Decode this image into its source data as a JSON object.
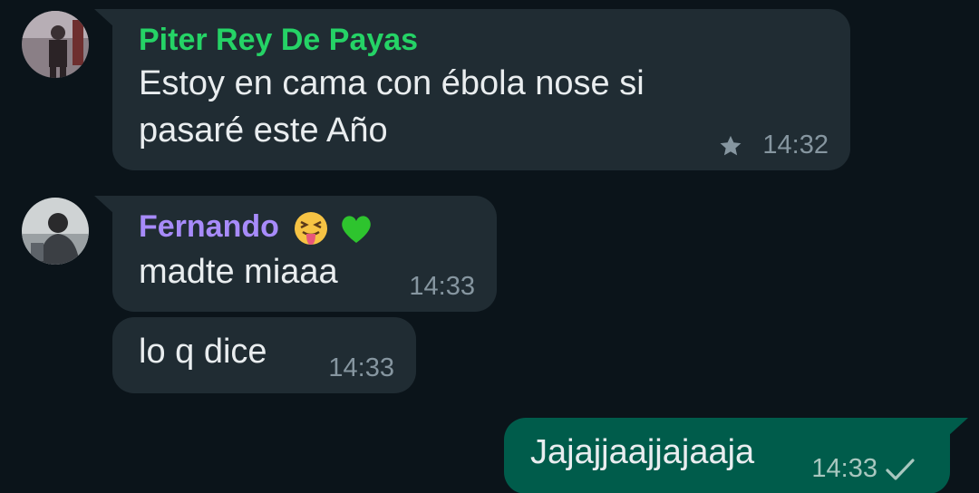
{
  "messages": [
    {
      "sender": "Piter Rey De Payas",
      "sender_color": "#25d366",
      "lines": [
        "Estoy en cama con ébola nose si",
        "pasaré este Año"
      ],
      "time": "14:32",
      "starred": true,
      "avatar_icon": "person-avatar-icon"
    },
    {
      "sender": "Fernando",
      "sender_emojis": [
        "😝",
        "💚"
      ],
      "sender_color": "#a78bfa",
      "text": "madte miaaa",
      "time": "14:33",
      "avatar_icon": "person-avatar-icon"
    },
    {
      "text": "lo q dice",
      "time": "14:33"
    },
    {
      "text": "Jajajjaajjajaaja",
      "time": "14:33",
      "outgoing": true,
      "status": "sent-check-icon"
    }
  ],
  "colors": {
    "background": "#0b141a",
    "incoming_bubble": "#202c33",
    "outgoing_bubble": "#005c4b",
    "meta_text": "#8696a0"
  }
}
